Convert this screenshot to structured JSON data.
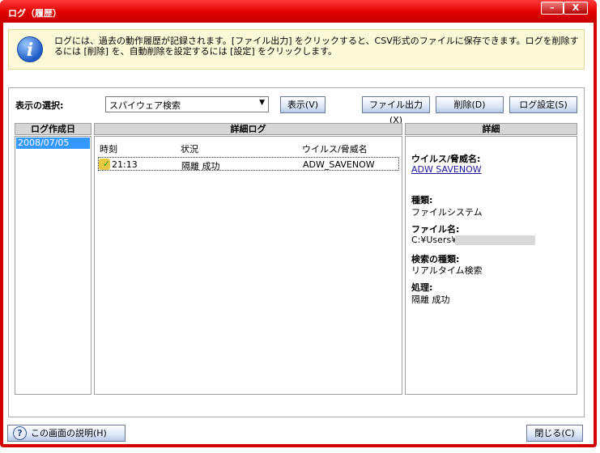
{
  "window": {
    "title": "ログ（履歴）",
    "minimize": "–",
    "close": "X"
  },
  "info": {
    "text": "ログには、過去の動作履歴が記録されます。[ファイル出力] をクリックすると、CSV形式のファイルに保存できます。ログを削除するには [削除] を、自動削除を設定するには [設定] をクリックします。"
  },
  "toolbar": {
    "select_label": "表示の選択:",
    "select_value": "スパイウェア検索",
    "show": "表示(V)",
    "export": "ファイル出力(X)",
    "delete": "削除(D)",
    "settings": "ログ設定(S)"
  },
  "dates": {
    "header": "ログ作成日",
    "items": [
      "2008/07/05"
    ]
  },
  "log": {
    "header": "詳細ログ",
    "columns": [
      "時刻",
      "状況",
      "ウイルス/脅威名"
    ],
    "rows": [
      {
        "time": "21:13",
        "status": "隔離 成功",
        "name": "ADW_SAVENOW"
      }
    ]
  },
  "detail": {
    "header": "詳細",
    "fields": [
      {
        "label": "ウイルス/脅威名:",
        "value": "ADW SAVENOW"
      },
      {
        "label": "種類:",
        "value": "ファイルシステム"
      },
      {
        "label": "ファイル名:",
        "value": "C:¥Users¥"
      },
      {
        "label": "検索の種類:",
        "value": "リアルタイム検索"
      },
      {
        "label": "処理:",
        "value": "隔離 成功"
      }
    ]
  },
  "footer": {
    "help": "この画面の説明(H)",
    "close": "閉じる(C)"
  }
}
